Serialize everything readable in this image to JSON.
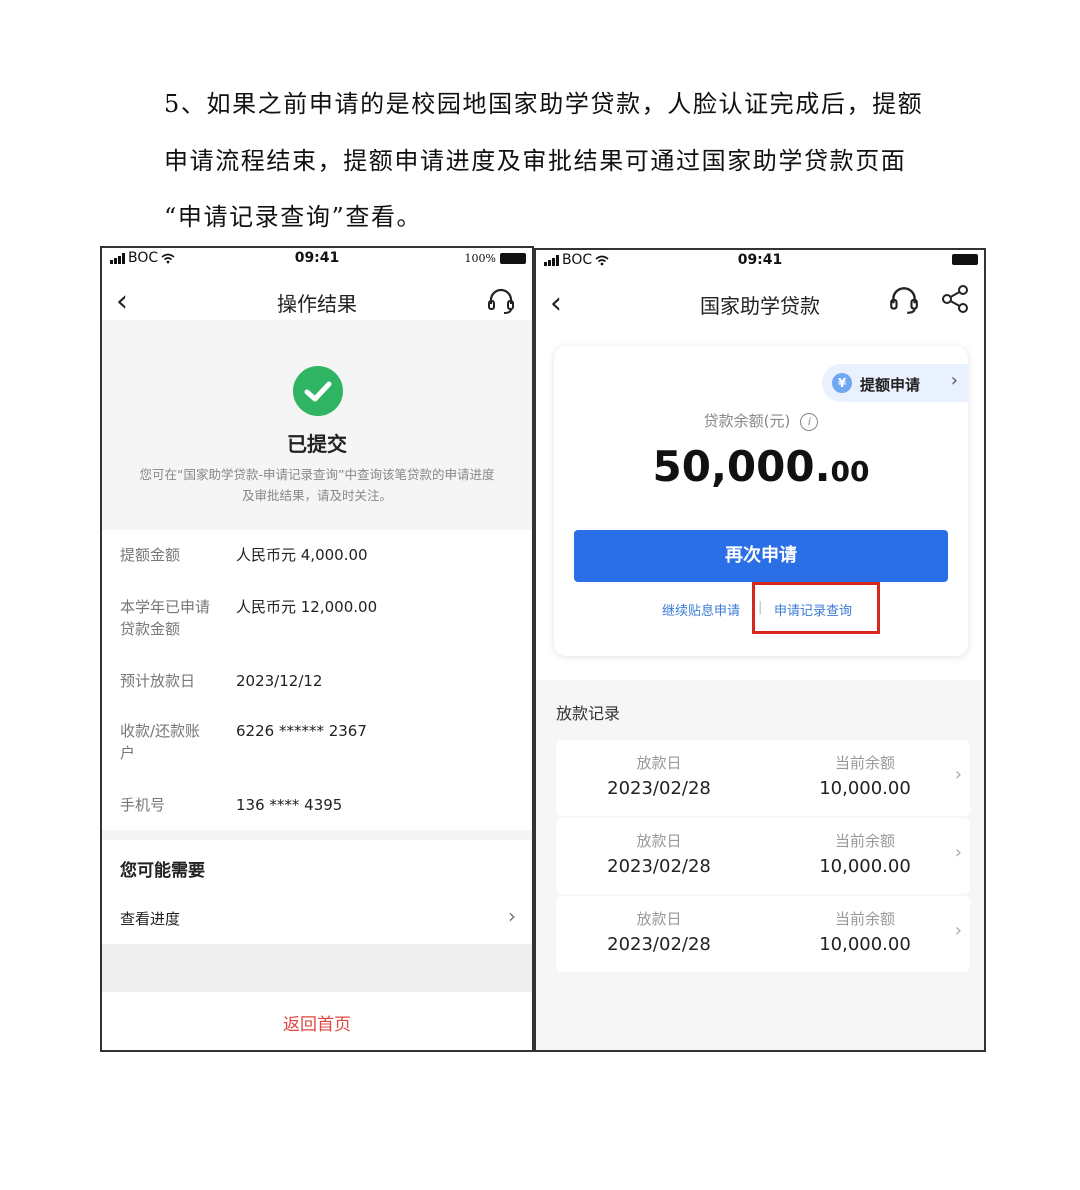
{
  "instruction": {
    "line1": "5、如果之前申请的是校园地国家助学贷款，人脸认证完成后，提额",
    "line2": "申请流程结束，提额申请进度及审批结果可通过国家助学贷款页面",
    "line3": "“申请记录查询”查看。"
  },
  "status_bar": {
    "carrier": "BOC",
    "time": "09:41",
    "battery": "100%"
  },
  "left_screen": {
    "back_glyph": "‹",
    "title": "操作结果",
    "success_title": "已提交",
    "success_desc": "您可在“国家助学贷款-申请记录查询”中查询该笔贷款的申请进度及审批结果，请及时关注。",
    "details": [
      {
        "label": "提额金额",
        "value": "人民币元 4,000.00"
      },
      {
        "label": "本学年已申请贷款金额",
        "value": "人民币元 12,000.00"
      },
      {
        "label": "预计放款日",
        "value": "2023/12/12"
      },
      {
        "label": "收款/还款账户",
        "value": "6226 ****** 2367"
      },
      {
        "label": "手机号",
        "value": "136 **** 4395"
      }
    ],
    "need_title": "您可能需要",
    "view_progress": "查看进度",
    "chevron": "›",
    "home_button": "返回首页"
  },
  "right_screen": {
    "back_glyph": "‹",
    "title": "国家助学贷款",
    "raise_tag": "提额申请",
    "raise_chevron": "›",
    "yen_glyph": "¥",
    "balance_label": "贷款余额(元)",
    "info_glyph": "i",
    "balance_integer": "50,000.",
    "balance_decimal": "00",
    "reapply_button": "再次申请",
    "link_subsidy": "继续贴息申请",
    "link_separator": "|",
    "link_records": "申请记录查询",
    "records_title": "放款记录",
    "records": [
      {
        "date_label": "放款日",
        "date": "2023/02/28",
        "bal_label": "当前余额",
        "balance": "10,000.00"
      },
      {
        "date_label": "放款日",
        "date": "2023/02/28",
        "bal_label": "当前余额",
        "balance": "10,000.00"
      },
      {
        "date_label": "放款日",
        "date": "2023/02/28",
        "bal_label": "当前余额",
        "balance": "10,000.00"
      }
    ],
    "chevron": "›"
  },
  "colors": {
    "success_green": "#2fb463",
    "primary_blue": "#2a6fe6",
    "highlight_red": "#d9261c",
    "home_red": "#e0453f"
  }
}
